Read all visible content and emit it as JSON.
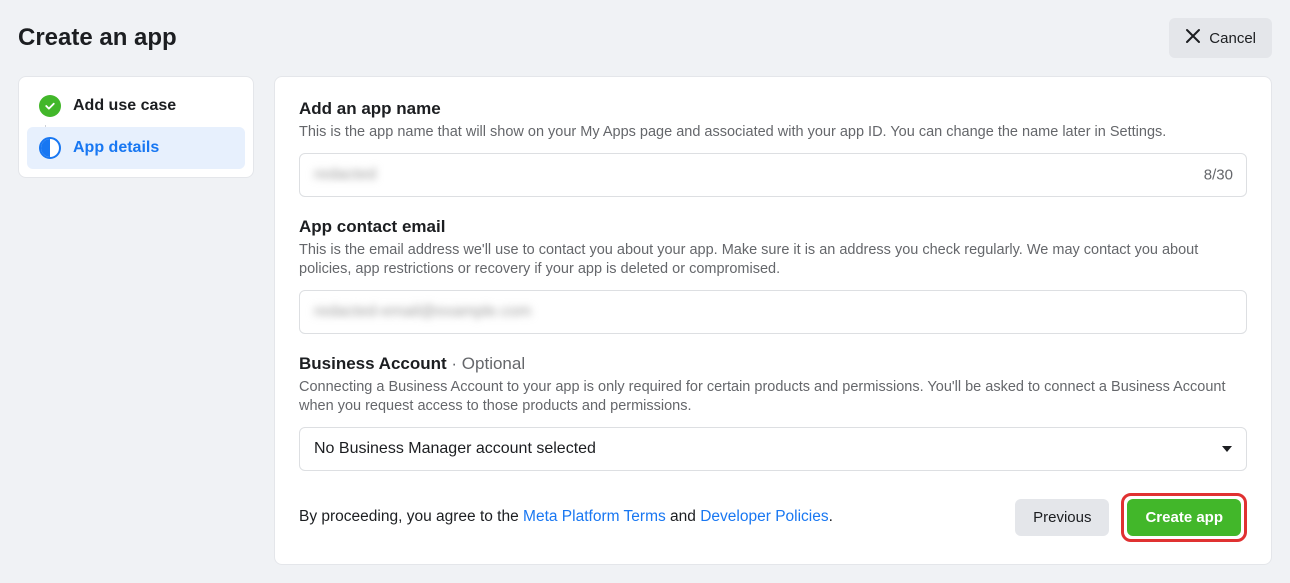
{
  "header": {
    "title": "Create an app",
    "cancel_label": "Cancel"
  },
  "sidebar": {
    "items": [
      {
        "label": "Add use case",
        "status": "done"
      },
      {
        "label": "App details",
        "status": "current"
      }
    ]
  },
  "form": {
    "app_name": {
      "label": "Add an app name",
      "description": "This is the app name that will show on your My Apps page and associated with your app ID. You can change the name later in Settings.",
      "value": "redacted",
      "char_count": "8/30"
    },
    "contact_email": {
      "label": "App contact email",
      "description": "This is the email address we'll use to contact you about your app. Make sure it is an address you check regularly. We may contact you about policies, app restrictions or recovery if your app is deleted or compromised.",
      "value": "redacted-email@example.com"
    },
    "business_account": {
      "label": "Business Account",
      "optional_suffix": " · Optional",
      "description": "Connecting a Business Account to your app is only required for certain products and permissions. You'll be asked to connect a Business Account when you request access to those products and permissions.",
      "selected": "No Business Manager account selected"
    }
  },
  "footer": {
    "agree_prefix": "By proceeding, you agree to the ",
    "link1": "Meta Platform Terms",
    "agree_mid": " and ",
    "link2": "Developer Policies",
    "agree_suffix": ".",
    "previous_label": "Previous",
    "create_label": "Create app"
  }
}
